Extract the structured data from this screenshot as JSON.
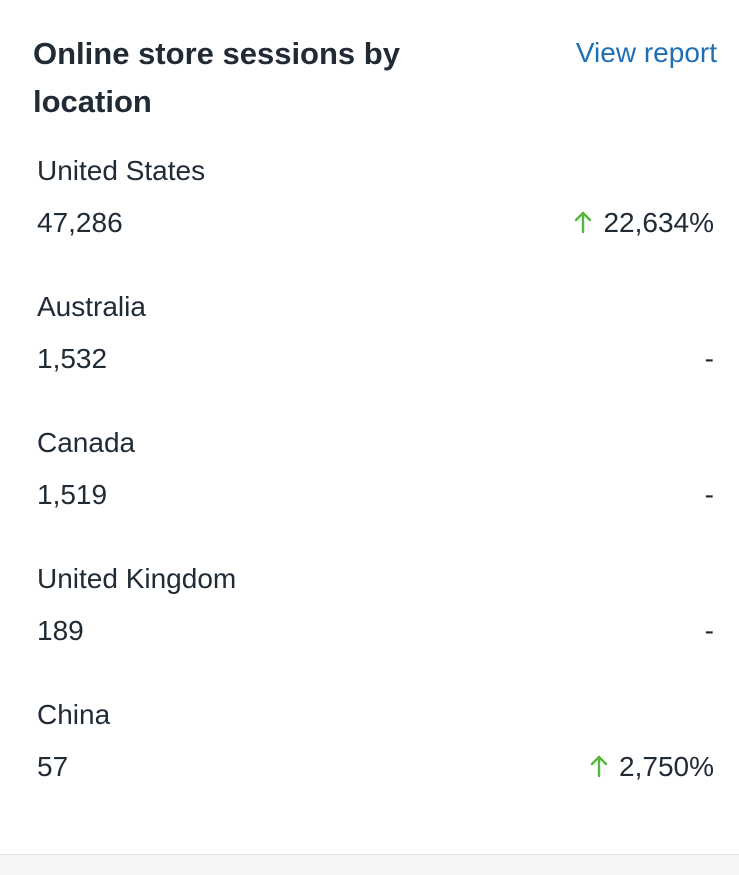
{
  "card": {
    "title": "Online store sessions by location",
    "view_report_label": "View report"
  },
  "colors": {
    "link": "#1f6fb5",
    "positive": "#50b83c",
    "text": "#212b36"
  },
  "rows": [
    {
      "country": "United States",
      "sessions": "47,286",
      "change": "22,634%",
      "trend": "up"
    },
    {
      "country": "Australia",
      "sessions": "1,532",
      "change": "-",
      "trend": "none"
    },
    {
      "country": "Canada",
      "sessions": "1,519",
      "change": "-",
      "trend": "none"
    },
    {
      "country": "United Kingdom",
      "sessions": "189",
      "change": "-",
      "trend": "none"
    },
    {
      "country": "China",
      "sessions": "57",
      "change": "2,750%",
      "trend": "up"
    }
  ]
}
